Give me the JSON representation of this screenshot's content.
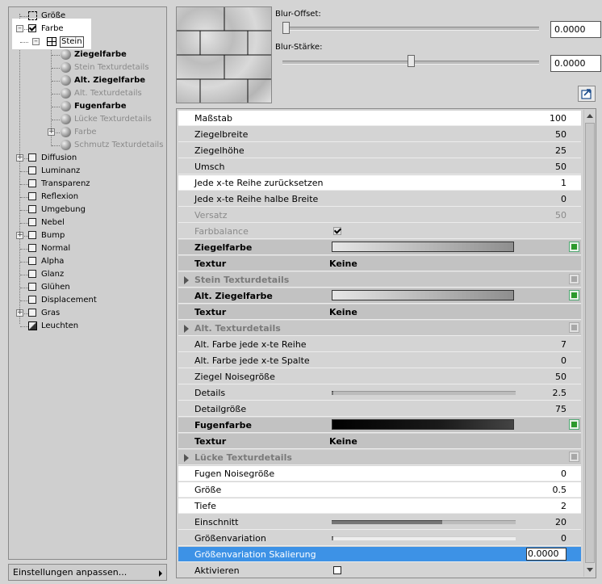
{
  "tree": {
    "items": [
      {
        "label": "Größe",
        "style": "normal"
      },
      {
        "label": "Farbe",
        "style": "normal"
      },
      {
        "label": "Stein",
        "style": "normal"
      },
      {
        "label": "Ziegelfarbe",
        "style": "bold"
      },
      {
        "label": "Stein Texturdetails",
        "style": "grey"
      },
      {
        "label": "Alt. Ziegelfarbe",
        "style": "bold"
      },
      {
        "label": "Alt. Texturdetails",
        "style": "grey"
      },
      {
        "label": "Fugenfarbe",
        "style": "bold"
      },
      {
        "label": "Lücke Texturdetails",
        "style": "grey"
      },
      {
        "label": "Farbe",
        "style": "grey"
      },
      {
        "label": "Schmutz Texturdetails",
        "style": "grey"
      },
      {
        "label": "Diffusion",
        "style": "normal"
      },
      {
        "label": "Luminanz",
        "style": "normal"
      },
      {
        "label": "Transparenz",
        "style": "normal"
      },
      {
        "label": "Reflexion",
        "style": "normal"
      },
      {
        "label": "Umgebung",
        "style": "normal"
      },
      {
        "label": "Nebel",
        "style": "normal"
      },
      {
        "label": "Bump",
        "style": "normal"
      },
      {
        "label": "Normal",
        "style": "normal"
      },
      {
        "label": "Alpha",
        "style": "normal"
      },
      {
        "label": "Glanz",
        "style": "normal"
      },
      {
        "label": "Glühen",
        "style": "normal"
      },
      {
        "label": "Displacement",
        "style": "normal"
      },
      {
        "label": "Gras",
        "style": "normal"
      },
      {
        "label": "Leuchten",
        "style": "normal"
      }
    ]
  },
  "settings_button": {
    "label": "Einstellungen anpassen..."
  },
  "preview": {
    "blur_offset": {
      "label": "Blur-Offset:",
      "value": "0.0000",
      "level": 0.0
    },
    "blur_strength": {
      "label": "Blur-Stärke:",
      "value": "0.0000",
      "level": 0.5
    }
  },
  "props": [
    {
      "label": "Maßstab",
      "value": "100",
      "kind": "white"
    },
    {
      "label": "Ziegelbreite",
      "value": "50",
      "kind": "normal"
    },
    {
      "label": "Ziegelhöhe",
      "value": "25",
      "kind": "normal"
    },
    {
      "label": "Umsch",
      "value": "50",
      "kind": "normal"
    },
    {
      "label": "Jede x-te Reihe zurücksetzen",
      "value": "1",
      "kind": "white"
    },
    {
      "label": "Jede x-te Reihe halbe Breite",
      "value": "0",
      "kind": "normal"
    },
    {
      "label": "Versatz",
      "value": "50",
      "kind": "dis"
    },
    {
      "label": "Farbbalance",
      "value": "",
      "kind": "dischk"
    },
    {
      "label": "Ziegelfarbe",
      "value": "",
      "kind": "color",
      "gradient": "light"
    },
    {
      "label": "Textur",
      "value": "Keine",
      "kind": "tex"
    },
    {
      "label": "Stein Texturdetails",
      "value": "",
      "kind": "group"
    },
    {
      "label": "Alt. Ziegelfarbe",
      "value": "",
      "kind": "color",
      "gradient": "light"
    },
    {
      "label": "Textur",
      "value": "Keine",
      "kind": "tex"
    },
    {
      "label": "Alt. Texturdetails",
      "value": "",
      "kind": "group"
    },
    {
      "label": "Alt. Farbe jede x-te Reihe",
      "value": "7",
      "kind": "normal"
    },
    {
      "label": "Alt. Farbe jede x-te Spalte",
      "value": "0",
      "kind": "normal"
    },
    {
      "label": "Ziegel Noisegröße",
      "value": "50",
      "kind": "normal"
    },
    {
      "label": "Details",
      "value": "2.5",
      "kind": "bar",
      "level": 0.01
    },
    {
      "label": "Detailgröße",
      "value": "75",
      "kind": "normal"
    },
    {
      "label": "Fugenfarbe",
      "value": "",
      "kind": "color",
      "gradient": "dark"
    },
    {
      "label": "Textur",
      "value": "Keine",
      "kind": "tex"
    },
    {
      "label": "Lücke Texturdetails",
      "value": "",
      "kind": "group"
    },
    {
      "label": "Fugen Noisegröße",
      "value": "0",
      "kind": "white"
    },
    {
      "label": "Größe",
      "value": "0.5",
      "kind": "white"
    },
    {
      "label": "Tiefe",
      "value": "2",
      "kind": "white"
    },
    {
      "label": "Einschnitt",
      "value": "20",
      "kind": "bar",
      "level": 0.6
    },
    {
      "label": "Größenvariation",
      "value": "0",
      "kind": "barwhite",
      "level": 0.0
    },
    {
      "label": "Größenvariation Skalierung",
      "value": "0.0000",
      "kind": "selected"
    },
    {
      "label": "Aktivieren",
      "value": "",
      "kind": "check"
    }
  ],
  "colors": {
    "accent": "#3d92e6",
    "panel": "#d4d4d4",
    "refresh_green": "#2c9a2c"
  }
}
